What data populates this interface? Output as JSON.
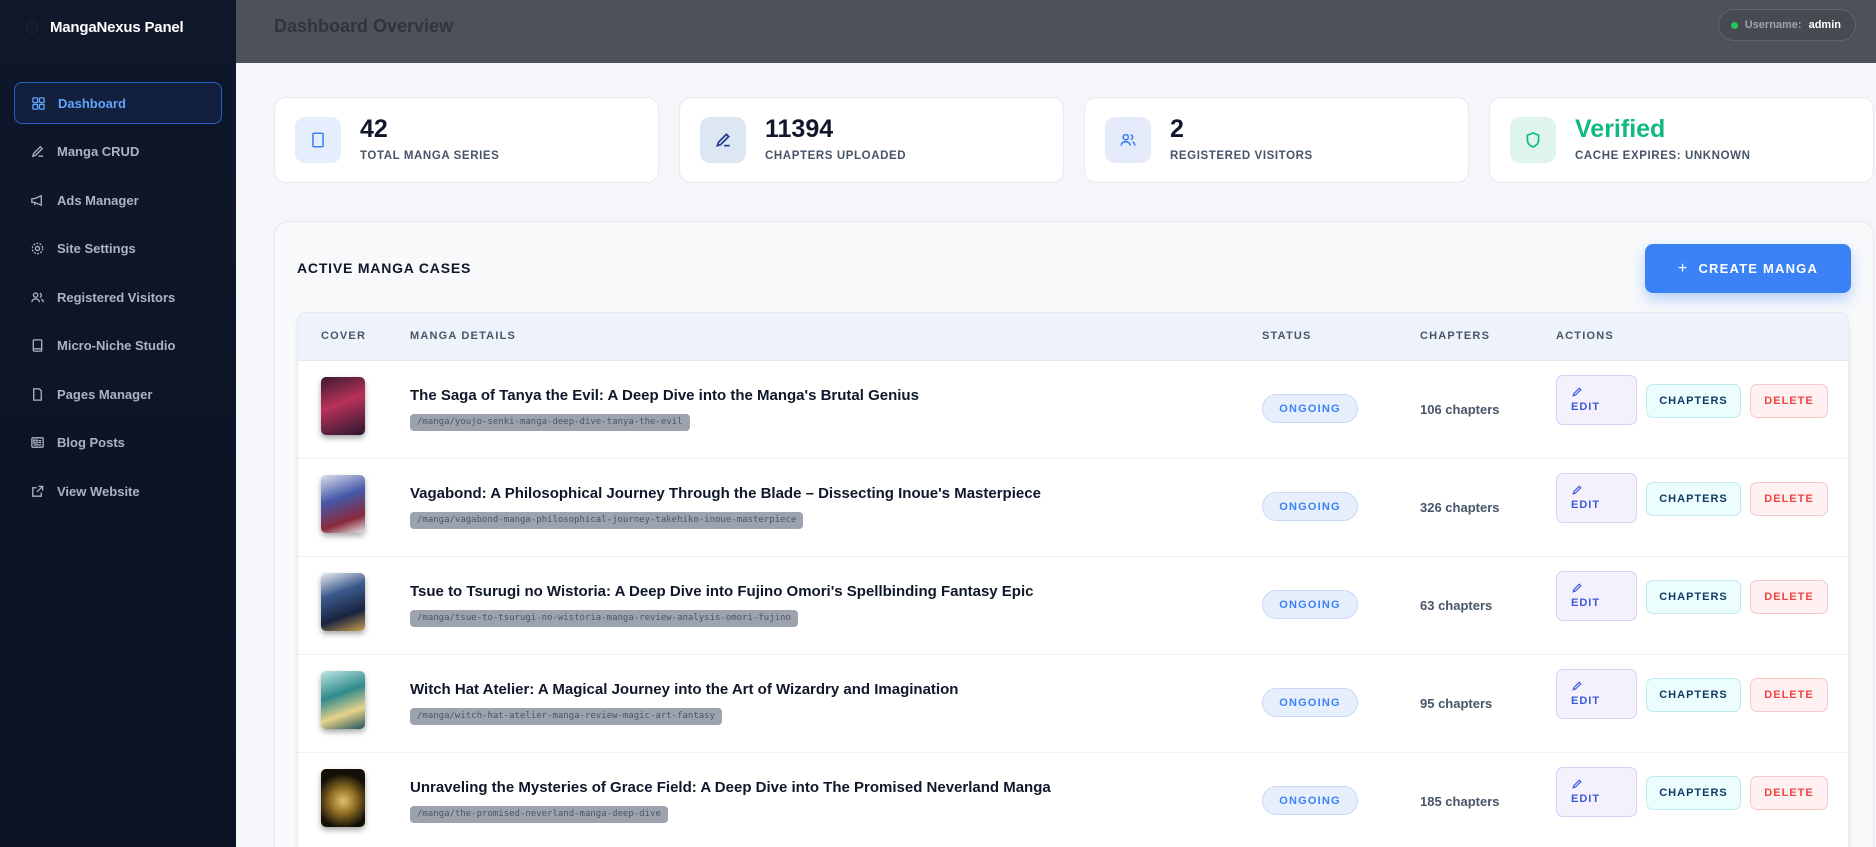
{
  "app": {
    "name": "MangaNexus Panel"
  },
  "sidebar": {
    "items": [
      {
        "label": "Dashboard",
        "icon": "grid-icon",
        "active": true
      },
      {
        "label": "Manga CRUD",
        "icon": "pencil-icon"
      },
      {
        "label": "Ads Manager",
        "icon": "megaphone-icon"
      },
      {
        "label": "Site Settings",
        "icon": "gear-icon"
      },
      {
        "label": "Registered Visitors",
        "icon": "users-icon"
      },
      {
        "label": "Micro-Niche Studio",
        "icon": "book-icon"
      },
      {
        "label": "Pages Manager",
        "icon": "file-icon"
      },
      {
        "label": "Blog Posts",
        "icon": "newspaper-icon"
      },
      {
        "label": "View Website",
        "icon": "external-link-icon"
      }
    ]
  },
  "header": {
    "title": "Dashboard Overview",
    "user_label": "Username:",
    "user_name": "admin"
  },
  "stats": [
    {
      "value": "42",
      "label": "TOTAL MANGA SERIES",
      "icon": "book-icon",
      "color": "#3b82f6"
    },
    {
      "value": "11394",
      "label": "CHAPTERS UPLOADED",
      "icon": "pencil-icon",
      "color": "#1e3a8a"
    },
    {
      "value": "2",
      "label": "REGISTERED VISITORS",
      "icon": "users-icon",
      "color": "#3b82f6"
    },
    {
      "value": "Verified",
      "label": "CACHE EXPIRES: UNKNOWN",
      "icon": "shield-icon",
      "color": "#10b981"
    }
  ],
  "main": {
    "section_title": "ACTIVE MANGA CASES",
    "create_label": "CREATE MANGA",
    "columns": [
      "COVER",
      "MANGA DETAILS",
      "STATUS",
      "CHAPTERS",
      "ACTIONS"
    ],
    "actions": {
      "edit": "EDIT",
      "chapters": "CHAPTERS",
      "delete": "DELETE"
    },
    "rows": [
      {
        "title": "The Saga of Tanya the Evil: A Deep Dive into the Manga's Brutal Genius",
        "slug": "/manga/youjo-senki-manga-deep-dive-tanya-the-evil",
        "status": "ONGOING",
        "chapters": "106 chapters"
      },
      {
        "title": "Vagabond: A Philosophical Journey Through the Blade – Dissecting Inoue's Masterpiece",
        "slug": "/manga/vagabond-manga-philosophical-journey-takehiko-inoue-masterpiece",
        "status": "ONGOING",
        "chapters": "326 chapters"
      },
      {
        "title": "Tsue to Tsurugi no Wistoria: A Deep Dive into Fujino Omori's Spellbinding Fantasy Epic",
        "slug": "/manga/tsue-to-tsurugi-no-wistoria-manga-review-analysis-omori-fujino",
        "status": "ONGOING",
        "chapters": "63 chapters"
      },
      {
        "title": "Witch Hat Atelier: A Magical Journey into the Art of Wizardry and Imagination",
        "slug": "/manga/witch-hat-atelier-manga-review-magic-art-fantasy",
        "status": "ONGOING",
        "chapters": "95 chapters"
      },
      {
        "title": "Unraveling the Mysteries of Grace Field: A Deep Dive into The Promised Neverland Manga",
        "slug": "/manga/the-promised-neverland-manga-deep-dive",
        "status": "ONGOING",
        "chapters": "185 chapters"
      }
    ]
  }
}
